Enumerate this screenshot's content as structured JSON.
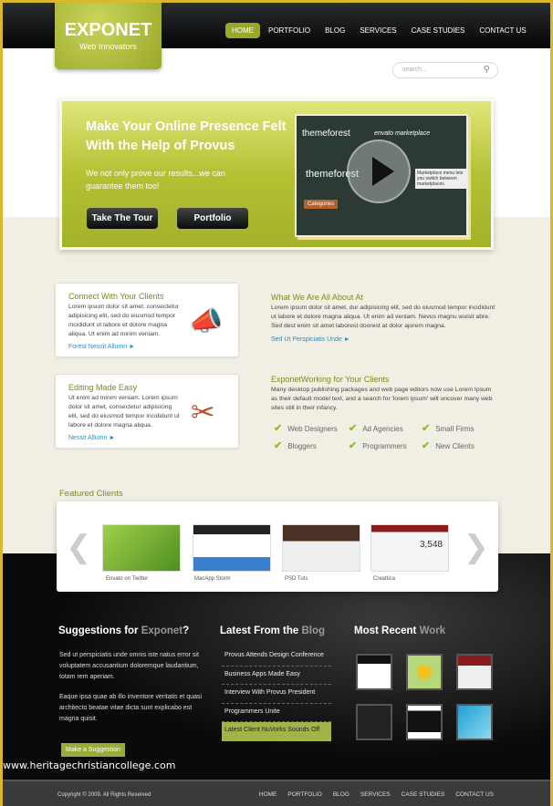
{
  "brand": {
    "name": "EXPONET",
    "tagline": "Web Innovators"
  },
  "nav": [
    "HOME",
    "PORTFOLIO",
    "BLOG",
    "SERVICES",
    "CASE STUDIES",
    "CONTACT US"
  ],
  "search": {
    "placeholder": "search..."
  },
  "hero": {
    "title": "Make Your Online Presence Felt With the Help of Provus",
    "subtitle": "We not only prove our results...we can guarantee them too!",
    "buttons": [
      "Take The Tour",
      "Portfolio"
    ],
    "video": {
      "logo1": "themeforest",
      "logo2": "envato marketplace",
      "category": "Categories",
      "tooltip": "Marketplace menu lets you switch between marketplaces"
    }
  },
  "boxes": [
    {
      "title": "Connect With Your Clients",
      "text": "Lorem ipsum dolor sit amet, consectetur adipisicing elit, sed do eiusmod tempor incididunt ut labore et dolore magna aliqua. Ut enim ad minim veniam.",
      "link": "Forest Nessit Allumn ►",
      "icon": "megaphone-icon"
    },
    {
      "title": "Editing Made Easy",
      "text": "Ut enim ad minim veniam. Lorem ipsum dolor sit amet, consectetur adipisicing elit, sed do eiusmod tempor incididunt ut labore et dolore magna aliqua.",
      "link": "Nessit Allumn ►",
      "icon": "scissors-icon"
    }
  ],
  "about": {
    "title": "What We Are All About At",
    "text": "Lorem ipsum dolor sit amet, dur adipisicing elit, sed do eiusmod tempor incididunt ut labore et dolore magna aliqua. Ut enim ad veniam. Nevus magnu wuisit abre. Sed dest enim sit amet laborest doorest at dolor ajorem magna.",
    "link": "Sed Ut Perspiciatis Unde ►"
  },
  "working": {
    "title": "ExponetWorking for Your Clients",
    "text": "Many desktop publishing packages and web page editors now use Lorem Ipsum as their default model text, and a search for 'lorem ipsum' will uncover many web sites still in their infancy.",
    "checks": [
      "Web Designers",
      "Ad Agencies",
      "Small Firms",
      "Bloggers",
      "Programmers",
      "New Clients"
    ]
  },
  "featured": {
    "title": "Featured Clients",
    "clients": [
      "Envato on Twitter",
      "MacApp Storm",
      "PSD Tuts",
      "Creattica"
    ],
    "counter": "3,548"
  },
  "suggestions": {
    "title": "Suggestions for ",
    "accent": "Exponet",
    "q": "?",
    "p1": "Sed ut perspiciatis unde omnis iste natus error sit voluptatem accusantium doloremque laudantium, totam rem aperiam.",
    "p2": "Eaque ipsa quae ab illo inventore veritatis et quasi architecto beatae vitae dicta sunt explicabo est magna quisit.",
    "button": "Make a Suggestion"
  },
  "blog": {
    "title": "Latest From the ",
    "accent": "Blog",
    "items": [
      "Provus Attends Design Conference",
      "Business Apps Made Easy",
      "Interview With Provus President",
      "Programmers Unite",
      "Latest Client NuVorks Sounds Off"
    ]
  },
  "work": {
    "title": "Most Recent ",
    "accent": "Work"
  },
  "watermark": "www.heritagechristiancollege.com",
  "footer": {
    "copyright": "Copyright © 2009. All Rights Reserved",
    "nav": [
      "HOME",
      "PORTFOLIO",
      "BLOG",
      "SERVICES",
      "CASE STUDIES",
      "CONTACT US"
    ]
  },
  "colors": {
    "accent": "#9aa828",
    "border": "#d8b92c",
    "link": "#2a8fc7"
  }
}
